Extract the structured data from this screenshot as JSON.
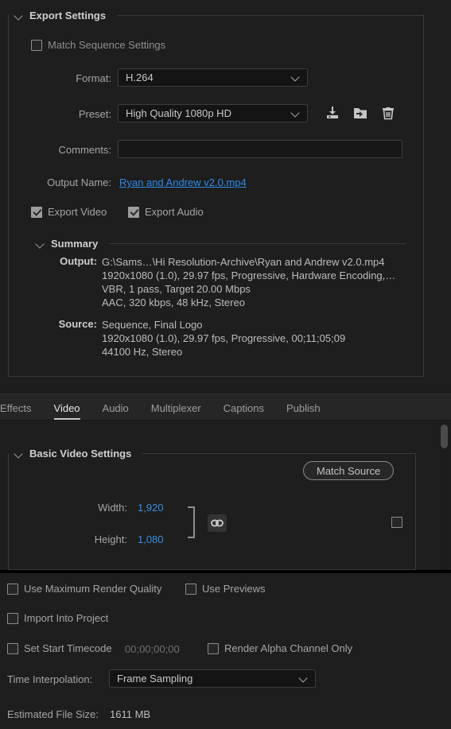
{
  "export_settings": {
    "title": "Export Settings",
    "match_sequence": {
      "label": "Match Sequence Settings",
      "checked": false
    },
    "format": {
      "label": "Format:",
      "value": "H.264"
    },
    "preset": {
      "label": "Preset:",
      "value": "High Quality 1080p HD"
    },
    "preset_icons": {
      "save": "save-preset-icon",
      "import": "import-preset-icon",
      "delete": "delete-preset-icon"
    },
    "comments": {
      "label": "Comments:",
      "value": "",
      "placeholder": ""
    },
    "output_name": {
      "label": "Output Name:",
      "value": "Ryan and Andrew v2.0.mp4",
      "color": "#2d8ceb"
    },
    "export_video": {
      "label": "Export Video",
      "checked": true
    },
    "export_audio": {
      "label": "Export Audio",
      "checked": true
    },
    "summary": {
      "title": "Summary",
      "output_label": "Output:",
      "output_lines": [
        "G:\\Sams…\\Hi Resolution-Archive\\Ryan and Andrew v2.0.mp4",
        "1920x1080 (1.0), 29.97 fps, Progressive, Hardware Encoding,…",
        "VBR, 1 pass, Target 20.00 Mbps",
        "AAC, 320 kbps, 48 kHz, Stereo"
      ],
      "source_label": "Source:",
      "source_lines": [
        "Sequence, Final Logo",
        "1920x1080 (1.0), 29.97 fps, Progressive, 00;11;05;09",
        "44100 Hz, Stereo"
      ]
    }
  },
  "tabs": [
    {
      "label": "Effects",
      "active": false
    },
    {
      "label": "Video",
      "active": true
    },
    {
      "label": "Audio",
      "active": false
    },
    {
      "label": "Multiplexer",
      "active": false
    },
    {
      "label": "Captions",
      "active": false
    },
    {
      "label": "Publish",
      "active": false
    }
  ],
  "basic_video": {
    "title": "Basic Video Settings",
    "match_source_button": "Match Source",
    "width": {
      "label": "Width:",
      "value": "1,920"
    },
    "height": {
      "label": "Height:",
      "value": "1,080"
    },
    "link_icon": "chain-link-icon",
    "match_checkbox_checked": false,
    "value_color": "#3b8fe0"
  },
  "render_options": {
    "use_max_render_quality": {
      "label": "Use Maximum Render Quality",
      "checked": false
    },
    "use_previews": {
      "label": "Use Previews",
      "checked": false
    },
    "import_into_project": {
      "label": "Import Into Project",
      "checked": false
    },
    "set_start_timecode": {
      "label": "Set Start Timecode",
      "checked": false
    },
    "start_timecode_value": "00;00;00;00",
    "render_alpha_only": {
      "label": "Render Alpha Channel Only",
      "checked": false
    },
    "time_interpolation": {
      "label": "Time Interpolation:",
      "value": "Frame Sampling"
    },
    "estimated_file_size": {
      "label": "Estimated File Size:",
      "value": "1611 MB"
    }
  }
}
